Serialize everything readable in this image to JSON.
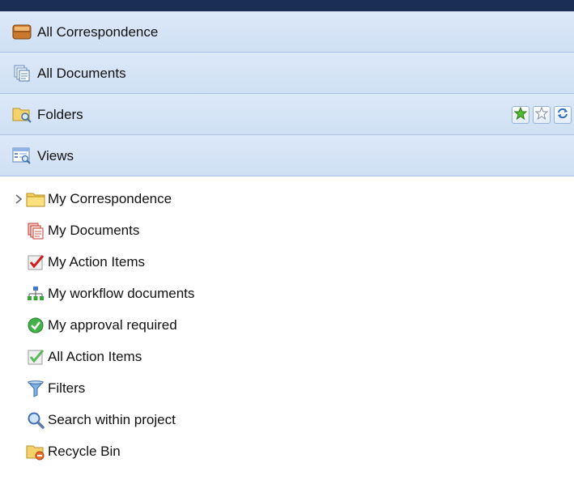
{
  "panels": [
    {
      "label": "All Correspondence",
      "icon": "inbox-icon"
    },
    {
      "label": "All Documents",
      "icon": "documents-icon"
    },
    {
      "label": "Folders",
      "icon": "folder-search-icon"
    },
    {
      "label": "Views",
      "icon": "views-icon"
    }
  ],
  "folder_tools": [
    {
      "icon": "add-favorite-icon"
    },
    {
      "icon": "favorite-icon"
    },
    {
      "icon": "refresh-icon"
    }
  ],
  "tree": [
    {
      "label": "My Correspondence",
      "icon": "folder-icon",
      "expandable": true
    },
    {
      "label": "My Documents",
      "icon": "red-documents-icon"
    },
    {
      "label": "My Action Items",
      "icon": "red-check-icon"
    },
    {
      "label": "My workflow documents",
      "icon": "workflow-icon"
    },
    {
      "label": "My approval required",
      "icon": "approval-icon"
    },
    {
      "label": "All Action Items",
      "icon": "green-check-icon"
    },
    {
      "label": "Filters",
      "icon": "filter-icon"
    },
    {
      "label": "Search within project",
      "icon": "search-icon"
    },
    {
      "label": "Recycle Bin",
      "icon": "recycle-bin-icon"
    }
  ],
  "colors": {
    "header_bar": "#1b2f55",
    "panel_bg": "#d4e3f6",
    "panel_border": "#a9c1e3"
  }
}
